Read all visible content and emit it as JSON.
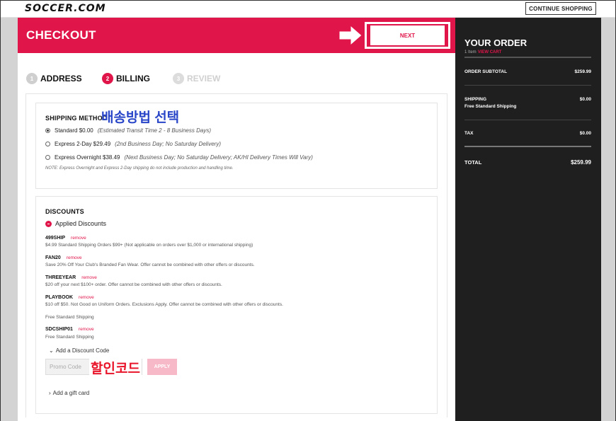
{
  "header": {
    "logo": "SOCCER.COM",
    "continue_shopping": "CONTINUE SHOPPING"
  },
  "checkout": {
    "title": "CHECKOUT",
    "next_label": "NEXT",
    "steps": [
      {
        "num": "1",
        "label": "ADDRESS"
      },
      {
        "num": "2",
        "label": "BILLING"
      },
      {
        "num": "3",
        "label": "REVIEW"
      }
    ],
    "active_step": 2
  },
  "shipping": {
    "title": "SHIPPING METHOD",
    "annotation_korean": "배송방법 선택",
    "options": [
      {
        "label": "Standard $0.00",
        "note": "(Estimated Transit Time 2 - 8 Business Days)",
        "selected": true
      },
      {
        "label": "Express 2-Day $29.49",
        "note": "(2nd Business Day; No Saturday Delivery)",
        "selected": false
      },
      {
        "label": "Express Overnight $38.49",
        "note": "(Next Business Day; No Saturday Delivery; AK/HI Delivery Times Will Vary)",
        "selected": false
      }
    ],
    "note": "NOTE: Express Overnight and Express 2-Day shipping do not include production and handling time."
  },
  "discounts": {
    "title": "DISCOUNTS",
    "applied_label": "Applied Discounts",
    "remove_label": "remove",
    "codes": [
      {
        "code": "499SHIP",
        "desc": "$4.99 Standard Shipping Orders $99+ (Not applicable on orders over $1,000 or international shipping)"
      },
      {
        "code": "FAN20",
        "desc": "Save 20% Off Your Club's Branded Fan Wear. Offer cannot be combined with other offers or discounts."
      },
      {
        "code": "THREEYEAR",
        "desc": "$20 off your next $100+ order. Offer cannot be combined with other offers or discounts."
      },
      {
        "code": "PLAYBOOK",
        "desc": "$10 off $50. Not Good on Uniform Orders. Exclusions Apply. Offer cannot be combined with other offers or discounts."
      }
    ],
    "free_shipping_text": "Free Standard Shipping",
    "last_code": {
      "code": "SDCSHIP01",
      "desc": "Free Standard Shipping"
    },
    "add_discount_label": "Add a Discount Code",
    "promo_placeholder": "Promo Code",
    "promo_annotation_korean": "할인코드",
    "apply_label": "APPLY",
    "gift_card_label": "Add a gift card"
  },
  "order": {
    "title": "YOUR ORDER",
    "item_count": "1 Item",
    "view_cart": "VIEW CART",
    "subtotal_label": "ORDER SUBTOTAL",
    "subtotal_value": "$259.99",
    "shipping_label": "SHIPPING",
    "shipping_sub": "Free Standard Shipping",
    "shipping_value": "$0.00",
    "tax_label": "TAX",
    "tax_value": "$0.00",
    "total_label": "TOTAL",
    "total_value": "$259.99"
  },
  "colors": {
    "accent": "#e0154a",
    "sidebar_bg": "#1f1f1f",
    "annotation_blue": "#2a46c8",
    "annotation_red": "#e8152b"
  },
  "icons": [
    "arrow-right-icon",
    "radio-icon",
    "chevron-down-icon",
    "chevron-right-icon",
    "applied-dot-icon"
  ]
}
